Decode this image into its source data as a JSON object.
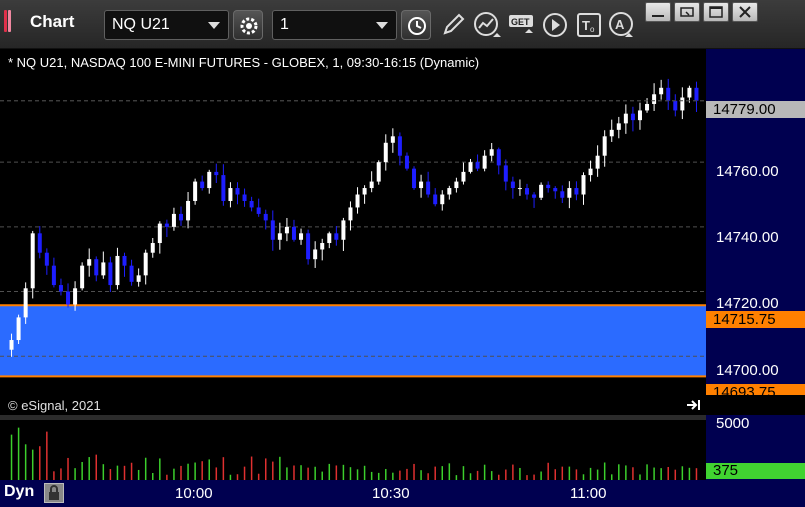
{
  "app": {
    "title": "Chart",
    "colors": {
      "brand_red": "#e0304a",
      "brand_pink": "#f088a0"
    }
  },
  "toolbar": {
    "symbol": "NQ U21",
    "interval": "1",
    "icons": [
      "settings-gear-icon",
      "clock-icon",
      "pencil-draw-icon",
      "studies-icon",
      "get-data-icon",
      "play-icon",
      "text-tool-icon",
      "alert-icon"
    ],
    "window_buttons": [
      "minimize-icon",
      "restore-icon",
      "maximize-icon",
      "close-icon"
    ]
  },
  "chart": {
    "title": "* NQ U21, NASDAQ 100 E-MINI FUTURES - GLOBEX, 1, 09:30-16:15 (Dynamic)",
    "copyright": "© eSignal, 2021",
    "price_labels": [
      "14760.00",
      "14740.00",
      "14720.00",
      "14700.00"
    ],
    "last_price": "14779.00",
    "band_high": "14715.75",
    "band_low": "14693.75",
    "colors": {
      "up": "#ffffff",
      "down": "#1e1eff",
      "band": "#2b6bff",
      "band_line": "#ff8000"
    }
  },
  "volume": {
    "max_label": "5000",
    "last_label": "375",
    "colors": {
      "up": "#3ccf2c",
      "down": "#e03030"
    }
  },
  "time_axis": {
    "labels": [
      "10:00",
      "10:30",
      "11:00"
    ],
    "mode": "Dyn"
  },
  "chart_data": {
    "type": "candlestick",
    "title": "* NQ U21, NASDAQ 100 E-MINI FUTURES - GLOBEX, 1, 09:30-16:15 (Dynamic)",
    "y_ticks": [
      14700,
      14720,
      14740,
      14760,
      14779
    ],
    "ylim": [
      14688,
      14795
    ],
    "x_ticks": [
      "10:00",
      "10:30",
      "11:00"
    ],
    "band": {
      "high": 14715.75,
      "low": 14693.75
    },
    "last": 14779,
    "close_series": [
      14705,
      14712,
      14721,
      14738,
      14732,
      14728,
      14722,
      14720,
      14716,
      14721,
      14728,
      14730,
      14725,
      14729,
      14722,
      14731,
      14728,
      14723,
      14725,
      14732,
      14735,
      14741,
      14740,
      14744,
      14742,
      14748,
      14754,
      14752,
      14757,
      14756,
      14748,
      14752,
      14750,
      14748,
      14746,
      14744,
      14742,
      14736,
      14738,
      14740,
      14736,
      14738,
      14730,
      14733,
      14735,
      14738,
      14736,
      14742,
      14746,
      14750,
      14752,
      14754,
      14760,
      14766,
      14768,
      14762,
      14758,
      14752,
      14754,
      14750,
      14747,
      14750,
      14752,
      14754,
      14757,
      14760,
      14758,
      14762,
      14764,
      14759,
      14754,
      14752,
      14752,
      14750,
      14749,
      14753,
      14752,
      14751,
      14749,
      14752,
      14750,
      14756,
      14758,
      14762,
      14768,
      14770,
      14772,
      14775,
      14773,
      14776,
      14778,
      14781,
      14783,
      14779,
      14776,
      14780,
      14783,
      14779
    ],
    "volume_max": 5000,
    "volume_last": 375
  }
}
